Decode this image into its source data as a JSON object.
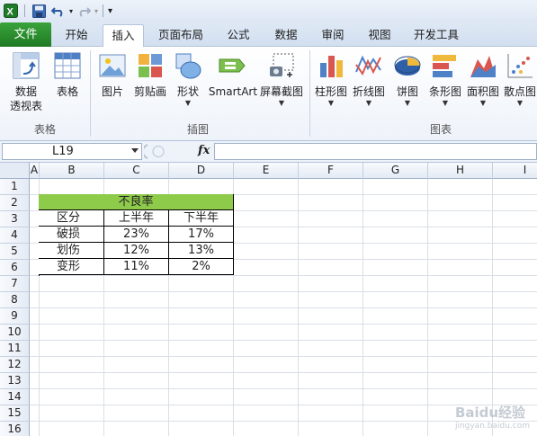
{
  "qat": {
    "dropdown_glyph": "▾"
  },
  "tabs": {
    "file": "文件",
    "items": [
      "开始",
      "插入",
      "页面布局",
      "公式",
      "数据",
      "审阅",
      "视图",
      "开发工具"
    ],
    "active": "插入"
  },
  "ribbon": {
    "groups": {
      "tables": "表格",
      "illustrations": "插图",
      "charts": "图表"
    },
    "buttons": {
      "pivot_line1": "数据",
      "pivot_line2": "透视表",
      "table": "表格",
      "picture": "图片",
      "clipart": "剪贴画",
      "shapes": "形状",
      "smartart": "SmartArt",
      "screenshot": "屏幕截图",
      "column": "柱形图",
      "line": "折线图",
      "pie": "饼图",
      "bar": "条形图",
      "area": "面积图",
      "scatter": "散点图"
    }
  },
  "formula_bar": {
    "name_box": "L19",
    "fx": "fx",
    "formula": ""
  },
  "grid": {
    "columns": [
      "A",
      "B",
      "C",
      "D",
      "E",
      "F",
      "G",
      "H",
      "I"
    ],
    "rows": [
      "1",
      "2",
      "3",
      "4",
      "5",
      "6",
      "7",
      "8",
      "9",
      "10",
      "11",
      "12",
      "13",
      "14",
      "15",
      "16"
    ]
  },
  "table": {
    "title": "不良率",
    "headers": [
      "区分",
      "上半年",
      "下半年"
    ],
    "rows": [
      [
        "破损",
        "23%",
        "17%"
      ],
      [
        "划伤",
        "12%",
        "13%"
      ],
      [
        "变形",
        "11%",
        "2%"
      ]
    ]
  },
  "watermark": {
    "main": "Baidu经验",
    "sub": "jingyan.baidu.com"
  },
  "colors": {
    "file_tab": "#2a8a2c",
    "title_fill": "#8fcb4b",
    "header_bg": "#e4ebf5"
  }
}
